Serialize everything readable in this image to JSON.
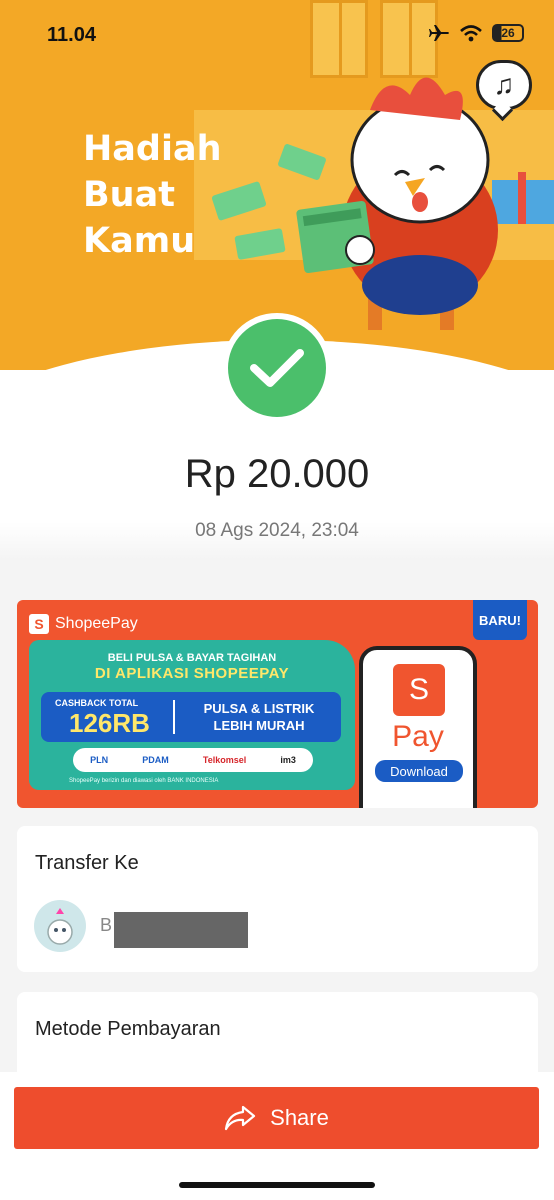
{
  "status_bar": {
    "time": "11.04",
    "battery": "26"
  },
  "hero": {
    "title_line1": "Hadiah",
    "title_line2": "Buat",
    "title_line3": "Kamu"
  },
  "payment": {
    "amount": "Rp 20.000",
    "datetime": "08 Ags 2024, 23:04",
    "status_icon": "check-icon",
    "status_color": "#4bbf6b"
  },
  "promo": {
    "brand": "ShopeePay",
    "headline_line1": "BELI PULSA & BAYAR TAGIHAN",
    "headline_line2": "DI APLIKASI SHOPEEPAY",
    "cashback_label": "CASHBACK TOTAL",
    "cashback_value": "126RB",
    "offer_line1": "PULSA & LISTRIK",
    "offer_line2": "LEBIH MURAH",
    "partners": [
      "PLN",
      "PDAM",
      "Telkomsel",
      "im3"
    ],
    "footnote": "ShopeePay berizin dan diawasi oleh BANK INDONESIA",
    "badge": "BARU!",
    "app_s": "S",
    "app_pay": "Pay",
    "download": "Download"
  },
  "transfer": {
    "title": "Transfer Ke",
    "recipient_initial": "B"
  },
  "payment_method": {
    "title": "Metode Pembayaran"
  },
  "share": {
    "label": "Share",
    "color": "#ee4d2d"
  }
}
